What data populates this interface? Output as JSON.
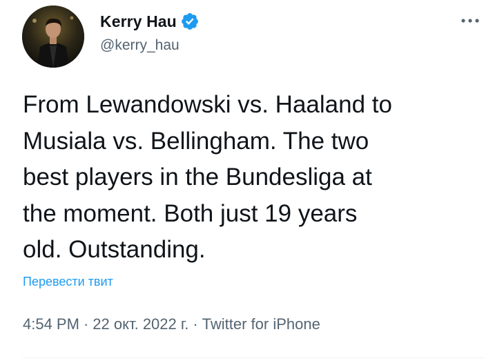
{
  "author": {
    "display_name": "Kerry Hau",
    "handle": "@kerry_hau",
    "verified": true,
    "avatar_icon": "avatar-photo"
  },
  "tweet": {
    "text": "From Lewandowski vs. Haaland to\nMusiala vs. Bellingham. The two\nbest players in the Bundesliga at\nthe moment. Both just 19 years\nold. Outstanding.",
    "translate_label": "Перевести твит"
  },
  "meta": {
    "time": "4:54 PM",
    "separator": "·",
    "date": "22 окт. 2022 г.",
    "source": "Twitter for iPhone"
  },
  "icons": {
    "more": "more-horizontal-icon",
    "verified": "verified-badge-icon"
  },
  "colors": {
    "link": "#1d9bf0",
    "secondary_text": "#536471",
    "primary_text": "#0f1419",
    "verified": "#1d9bf0"
  }
}
